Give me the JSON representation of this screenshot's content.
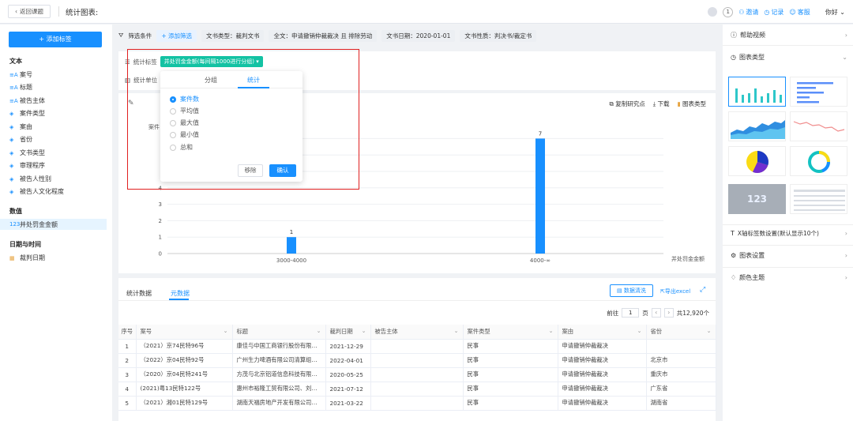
{
  "topbar": {
    "back_label": "返回课题",
    "title": "统计图表:",
    "badge_count": "1",
    "invite": "邀请",
    "record": "记录",
    "service": "客服",
    "user": "你好"
  },
  "sidebar": {
    "add_tag": "添加标签",
    "groups": {
      "text": "文本",
      "number": "数值",
      "datetime": "日期与时间"
    },
    "text_items": [
      "案号",
      "标题",
      "被告主体",
      "案件类型",
      "案由",
      "省份",
      "文书类型",
      "审理程序",
      "被告人性别",
      "被告人文化程度"
    ],
    "number_items": [
      "并处罚金金额"
    ],
    "date_items": [
      "裁判日期"
    ]
  },
  "filterbar": {
    "label": "筛选条件",
    "add": "添加筛选",
    "chips": [
      "文书类型：裁判文书",
      "全文：申请撤销仲裁裁决 且 排除劳动",
      "文书日期：2020-01-01",
      "文书性质：判决书/裁定书"
    ]
  },
  "config": {
    "stat_tag_label": "统计标签",
    "stat_tag_value": "并处罚金金额(每间隔1000进行分组)",
    "stat_unit_label": "统计单位"
  },
  "popup": {
    "tab_group": "分组",
    "tab_stat": "统计",
    "options": [
      "案件数",
      "平均值",
      "最大值",
      "最小值",
      "总和"
    ],
    "selected": "案件数",
    "remove": "移除",
    "confirm": "确认"
  },
  "chart_tools": {
    "copy": "复制研究点",
    "download": "下载",
    "chart_type": "图表类型"
  },
  "chart_data": {
    "type": "bar",
    "categories": [
      "3000-4000",
      "4000-∞"
    ],
    "values": [
      1,
      7
    ],
    "ylabel": "案件",
    "xlabel": "并处罚金金额",
    "ylim": [
      0,
      7
    ],
    "yticks": [
      0,
      1,
      2,
      3,
      4
    ],
    "color": "#1890ff",
    "grid": true
  },
  "data_table": {
    "tab_stats": "统计数据",
    "tab_meta": "元数据",
    "filter_btn": "数据清洗",
    "export_btn": "导出excel",
    "pager": {
      "prev_label": "前往",
      "page": "1",
      "page_unit": "页",
      "total": "共12,920个"
    },
    "columns": [
      "序号",
      "案号",
      "标题",
      "裁判日期",
      "被告主体",
      "案件类型",
      "案由",
      "省份"
    ],
    "rows": [
      [
        "1",
        "（2021）京74民特96号",
        "康佳与中国工商银行股份有限公...",
        "2021-12-29",
        "",
        "民事",
        "申请撤销仲裁裁决",
        ""
      ],
      [
        "2",
        "（2022）京04民特92号",
        "广州生力啤酒有限公司清算组与...",
        "2022-04-01",
        "",
        "民事",
        "申请撤销仲裁裁决",
        "北京市"
      ],
      [
        "3",
        "（2020）京04民特241号",
        "方茂与北京铝道信息科技有限公...",
        "2020-05-25",
        "",
        "民事",
        "申请撤销仲裁裁决",
        "重庆市"
      ],
      [
        "4",
        "(2021)粤13民特122号",
        "惠州市裕隆工贸有限公司、刘春...",
        "2021-07-12",
        "",
        "民事",
        "申请撤销仲裁裁决",
        "广东省"
      ],
      [
        "5",
        "（2021）湘01民特129号",
        "湖南天福房地产开发有限公司、...",
        "2021-03-22",
        "",
        "民事",
        "申请撤销仲裁裁决",
        "湖南省"
      ]
    ]
  },
  "rightbar": {
    "help_video": "帮助视频",
    "chart_types": "图表类型",
    "number_thumb": "123",
    "x_axis_setting": "X轴标签数设置(默认显示10个)",
    "chart_setting": "图表设置",
    "color_theme": "颜色主题"
  }
}
